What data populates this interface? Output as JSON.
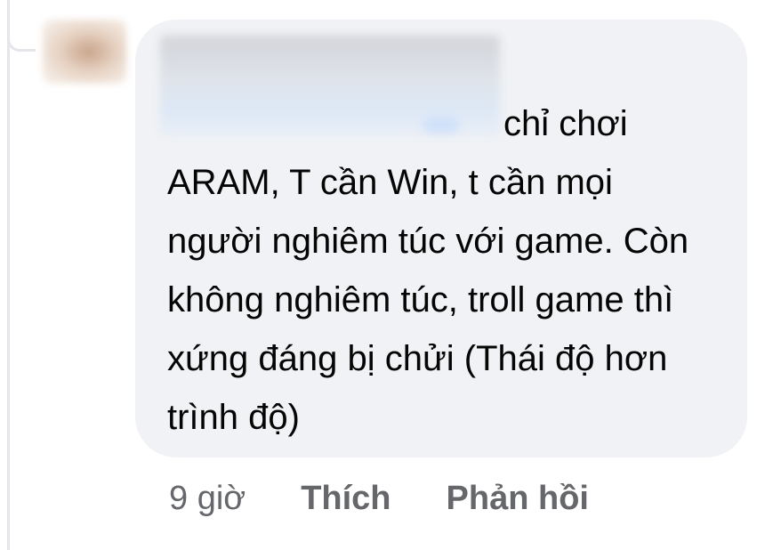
{
  "comment": {
    "text": "chỉ chơi ARAM, T cần Win, t cần mọi người nghiêm túc với game. Còn không nghiêm túc, troll game thì xứng đáng bị chửi (Thái độ hơn trình độ)",
    "actions": {
      "time": "9 giờ",
      "like_label": "Thích",
      "reply_label": "Phản hồi"
    }
  },
  "colors": {
    "bubble_bg": "#f0f2f5",
    "text": "#050505",
    "secondary_text": "#65676b",
    "thread_line": "#e4e6eb"
  }
}
